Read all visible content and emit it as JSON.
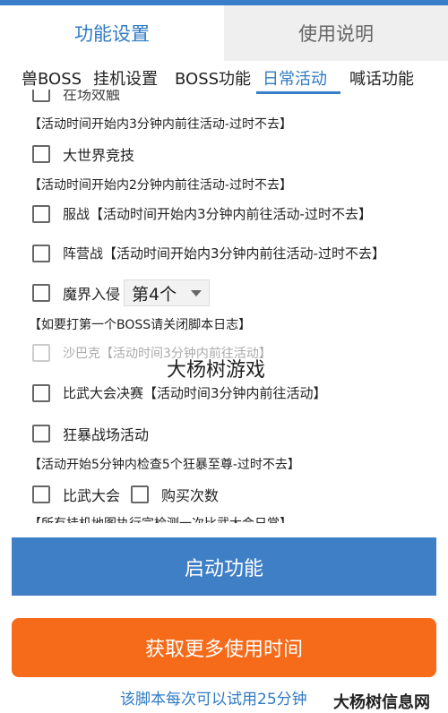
{
  "tabs": {
    "primary": "功能设置",
    "secondary": "使用说明"
  },
  "subtabs": [
    "兽BOSS",
    "挂机设置",
    "BOSS功能",
    "日常活动",
    "喊话功能"
  ],
  "list": {
    "clipped_top_label": "在场效触",
    "note1": "【活动时间开始内3分钟内前往活动-过时不去】",
    "world_arena": "大世界竞技",
    "note2": "【活动时间开始内2分钟内前往活动-过时不去】",
    "server_war": "服战【活动时间开始内3分钟内前往活动-过时不去】",
    "camp_war": "阵营战【活动时间开始内3分钟内前往活动-过时不去】",
    "demon_invasion": "魔界入侵",
    "demon_select_value": "第4个",
    "note3": "【如要打第一个BOSS请关闭脚本日志】",
    "sabac": "沙巴克【活动时间3分钟内前往活动】",
    "tournament_final": "比武大会决赛【活动时间3分钟内前往活动】",
    "berserk_battlefield": "狂暴战场活动",
    "note4": "【活动开始5分钟内检查5个狂暴至尊-过时不去】",
    "tournament": "比武大会",
    "buy_times": "购买次数",
    "clipped_bottom_note": "【所有挂机地图执行完检测一次比武大会日常】"
  },
  "watermark": "大杨树游戏",
  "buttons": {
    "start": "启动功能",
    "more_time": "获取更多使用时间"
  },
  "trial_note": "该脚本每次可以试用25分钟",
  "corner_mark": "大杨树信息网",
  "colors": {
    "accent_blue": "#3f7fc6",
    "tab_text_blue": "#2f7ac4",
    "orange": "#f56b19"
  }
}
